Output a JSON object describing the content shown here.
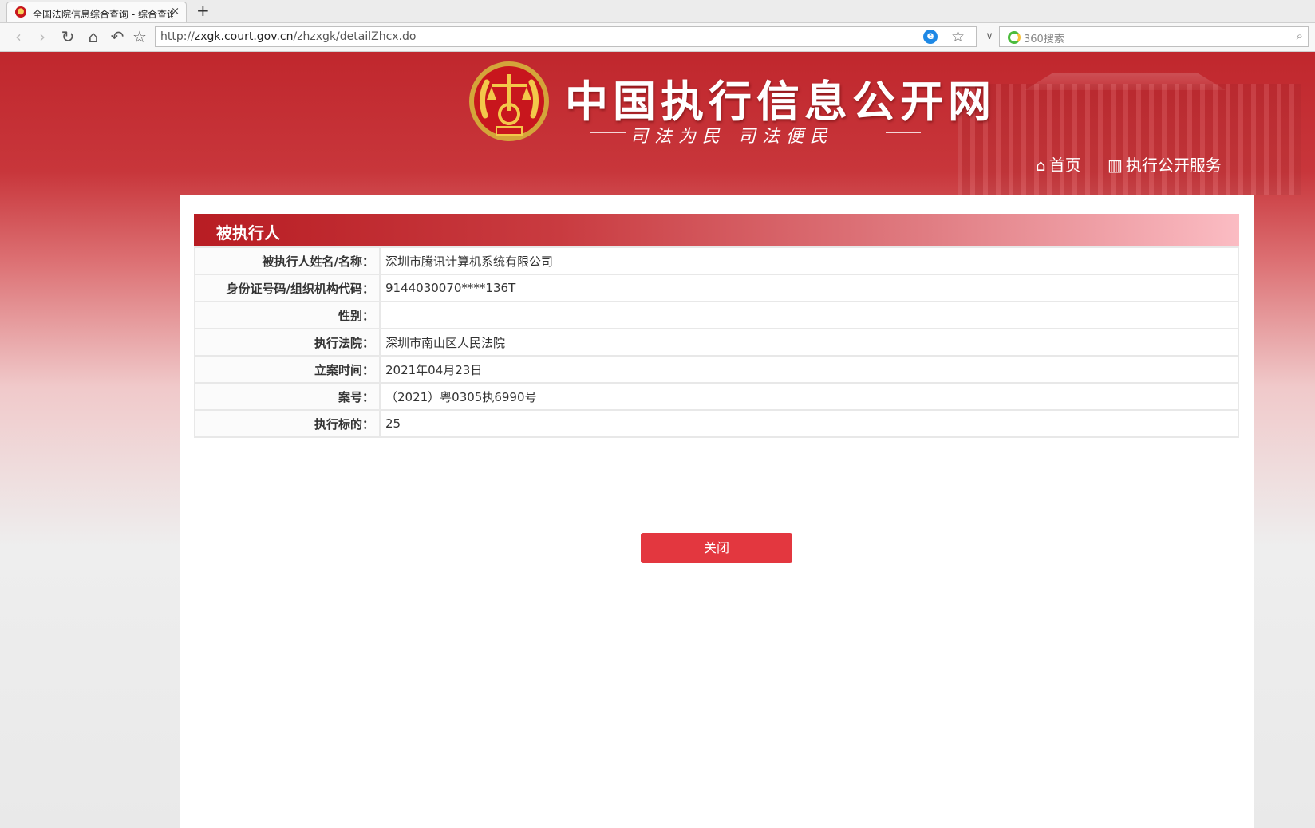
{
  "browser": {
    "tab_title": "全国法院信息综合查询 - 综合查询",
    "new_tab": "+",
    "close_tab": "×",
    "url_base": "http://",
    "url_host": "zxgk.court.gov.cn",
    "url_path": "/zhzxgk/detailZhcx.do",
    "search_placeholder": "360搜索"
  },
  "header": {
    "site_title": "中国执行信息公开网",
    "slogan": "司法为民  司法便民",
    "nav": [
      {
        "label": "首页",
        "icon": "home-icon"
      },
      {
        "label": "执行公开服务",
        "icon": "chart-icon"
      }
    ]
  },
  "section": {
    "title": "被执行人",
    "rows": [
      {
        "label": "被执行人姓名/名称：",
        "value": "深圳市腾讯计算机系统有限公司"
      },
      {
        "label": "身份证号码/组织机构代码：",
        "value": "9144030070****136T"
      },
      {
        "label": "性别：",
        "value": ""
      },
      {
        "label": "执行法院：",
        "value": "深圳市南山区人民法院"
      },
      {
        "label": "立案时间：",
        "value": "2021年04月23日"
      },
      {
        "label": "案号：",
        "value": "（2021）粤0305执6990号"
      },
      {
        "label": "执行标的：",
        "value": "25"
      }
    ]
  },
  "close_button": "关闭",
  "colors": {
    "brand_red": "#c0272d",
    "button_red": "#e3373f"
  }
}
